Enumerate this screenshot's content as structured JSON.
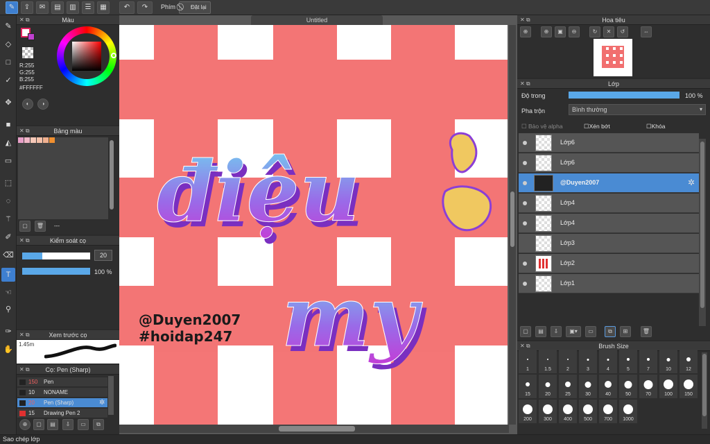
{
  "app": {
    "doc_tab": "Untitled",
    "status": "Sao chép lớp"
  },
  "toolbar": {
    "keys_label": "Phím",
    "reset_label": "Đặt lại"
  },
  "color_panel": {
    "title": "Màu",
    "r": "R:255",
    "g": "G:255",
    "b": "B:255",
    "hex": "#FFFFFF",
    "fg_color": "#ffffff",
    "accent": "#e0245e"
  },
  "palette_panel": {
    "title": "Bảng màu",
    "swatches": [
      "#e8a0c8",
      "#f3b8c8",
      "#f6c8b8",
      "#f4c0a8",
      "#f0b090",
      "#f09030"
    ],
    "footer_label": "---"
  },
  "brush_control": {
    "title": "Kiểm soát cọ",
    "size": "20",
    "opacity": "100 %",
    "size_frac": 0.3,
    "opacity_frac": 1.0
  },
  "preview_panel": {
    "title": "Xem trước cọ",
    "size_label": "1.45m"
  },
  "brush_list": {
    "title": "Cọ: Pen (Sharp)",
    "items": [
      {
        "size": "150",
        "name": "Pen",
        "color": "#222"
      },
      {
        "size": "10",
        "name": "NONAME",
        "color": "#222"
      },
      {
        "size": "20",
        "name": "Pen (Sharp)",
        "color": "#222"
      },
      {
        "size": "15",
        "name": "Drawing Pen 2",
        "color": "#e03030"
      }
    ]
  },
  "navigator": {
    "title": "Hoa tiêu"
  },
  "layers_panel": {
    "title": "Lớp",
    "opacity_label": "Độ trong",
    "opacity_value": "100 %",
    "blend_label": "Pha trộn",
    "blend_value": "Bình thường",
    "protect_alpha": "Bảo vệ alpha",
    "clip": "Xén bớt",
    "lock": "Khóa",
    "layers": [
      {
        "name": "Lớp6"
      },
      {
        "name": "Lớp6"
      },
      {
        "name": "@Duyen2007"
      },
      {
        "name": "Lớp4"
      },
      {
        "name": "Lớp4"
      },
      {
        "name": "Lớp3"
      },
      {
        "name": "Lớp2"
      },
      {
        "name": "Lớp1"
      }
    ]
  },
  "brush_size": {
    "title": "Brush Size",
    "sizes": [
      "1",
      "1.5",
      "2",
      "3",
      "4",
      "5",
      "7",
      "10",
      "12",
      "15",
      "20",
      "25",
      "30",
      "40",
      "50",
      "70",
      "100",
      "150",
      "200",
      "300",
      "400",
      "500",
      "700",
      "1000"
    ]
  },
  "canvas": {
    "word1": "điệu",
    "word2": "my",
    "tag1": "@Duyen2007",
    "tag2": "#hoidap247",
    "stripe_color": "#f04848",
    "text_color": "#8b3fd6",
    "accent_yellow": "#f0c860"
  }
}
